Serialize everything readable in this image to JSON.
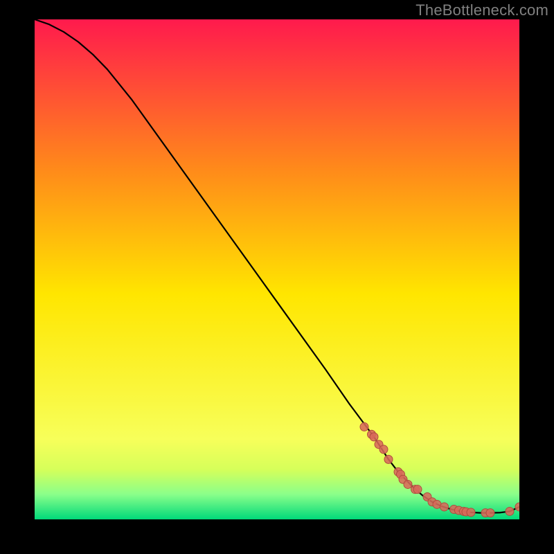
{
  "watermark": "TheBottleneck.com",
  "colors": {
    "frame_bg": "#000000",
    "curve": "#000000",
    "marker_fill": "#d86a5a",
    "marker_stroke": "#b04c3e",
    "grad_top": "#ff1a4d",
    "grad_mid_upper": "#ff8a1a",
    "grad_mid": "#ffe600",
    "grad_low1": "#f7ff5a",
    "grad_low2": "#d6ff5a",
    "grad_low3": "#8aff8a",
    "grad_bottom": "#00d97a"
  },
  "chart_data": {
    "type": "line",
    "title": "",
    "xlabel": "",
    "ylabel": "",
    "xlim": [
      0,
      100
    ],
    "ylim": [
      0,
      100
    ],
    "series": [
      {
        "name": "curve",
        "x": [
          0,
          3,
          6,
          9,
          12,
          15,
          20,
          30,
          40,
          50,
          60,
          65,
          70,
          73,
          75,
          78,
          80,
          82,
          84,
          86,
          88,
          90,
          92,
          94,
          96,
          98,
          100
        ],
        "values": [
          100,
          99,
          97.5,
          95.5,
          93,
          90,
          84,
          70.5,
          57,
          43.5,
          30,
          23,
          16.5,
          12,
          9.5,
          6.5,
          4.8,
          3.5,
          2.6,
          2.0,
          1.6,
          1.4,
          1.3,
          1.3,
          1.35,
          1.6,
          2.5
        ]
      }
    ],
    "markers": {
      "name": "points",
      "x": [
        68,
        69.5,
        70,
        71,
        72,
        73,
        75,
        75.5,
        76,
        77,
        78.5,
        79,
        81,
        82,
        83,
        84.5,
        86.5,
        87.5,
        88.5,
        89,
        90,
        93,
        94,
        98,
        100
      ],
      "values": [
        18.5,
        17,
        16.5,
        15,
        14,
        12,
        9.5,
        9,
        8,
        7,
        6,
        6,
        4.5,
        3.5,
        3,
        2.5,
        2,
        1.8,
        1.6,
        1.5,
        1.4,
        1.3,
        1.3,
        1.6,
        2.5
      ]
    }
  }
}
